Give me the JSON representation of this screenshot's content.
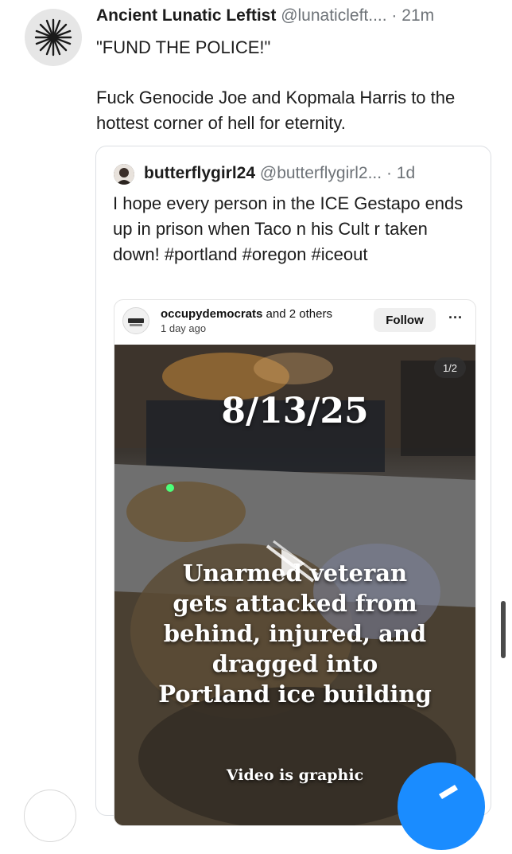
{
  "post": {
    "author_name": "Ancient Lunatic Leftist",
    "author_handle": "@lunaticleft....",
    "separator": "·",
    "time": "21m",
    "avatar_icon": "starburst-icon",
    "body": [
      "\"FUND THE POLICE!\"",
      "Fuck Genocide Joe and Kopmala Harris to the hottest corner of hell for eternity."
    ]
  },
  "quote": {
    "author_name": "butterflygirl24",
    "author_handle": "@butterflygirl2...",
    "separator": "·",
    "time": "1d",
    "body": "I hope every person in the ICE Gestapo ends up in prison when Taco n his Cult r taken down! #portland #oregon #iceout"
  },
  "embed": {
    "username": "occupydemocrats",
    "others": " and 2 others",
    "time": "1 day ago",
    "follow_label": "Follow",
    "more_label": "···",
    "counter": "1/2",
    "date_text": "8/13/25",
    "caption_lines": [
      "Unarmed veteran",
      "gets attacked from",
      "behind, injured, and",
      "dragged into",
      "Portland ice building"
    ],
    "warning": "Video is graphic"
  },
  "colors": {
    "text": "#1c1c1c",
    "muted": "#6e7378",
    "border": "#dcdfe3",
    "fab": "#1a8cff"
  }
}
